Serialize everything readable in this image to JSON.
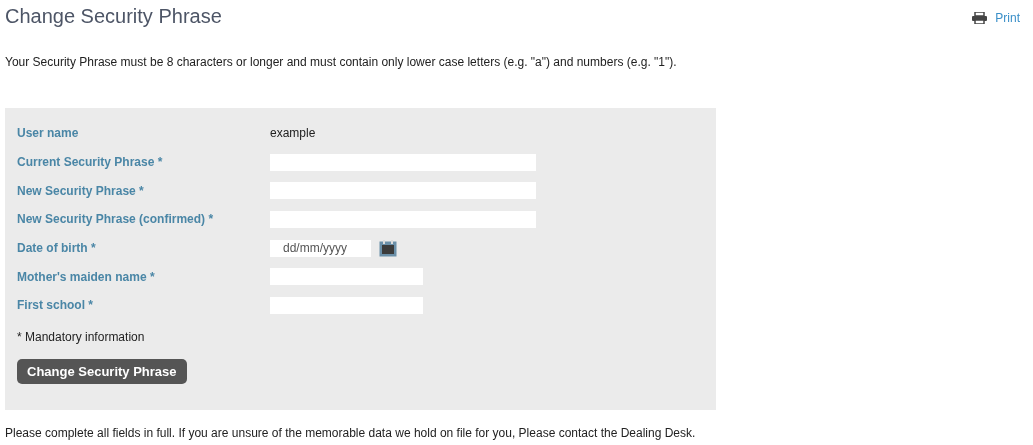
{
  "title": "Change Security Phrase",
  "print_link": "Print",
  "intro": "Your Security Phrase must be 8 characters or longer and must contain only lower case letters (e.g. \"a\") and numbers (e.g. \"1\").",
  "form": {
    "rows": [
      {
        "label": "User name",
        "kind": "value",
        "value": "example"
      },
      {
        "label": "Current Security Phrase *",
        "kind": "wide-input"
      },
      {
        "label": "New Security Phrase *",
        "kind": "wide-input"
      },
      {
        "label": "New Security Phrase (confirmed) *",
        "kind": "wide-input"
      },
      {
        "label": "Date of birth *",
        "kind": "date",
        "placeholder": "dd/mm/yyyy"
      },
      {
        "label": "Mother's maiden name *",
        "kind": "short-input"
      },
      {
        "label": "First school *",
        "kind": "short-input"
      }
    ],
    "mandatory_note": "* Mandatory information",
    "submit_button": "Change Security Phrase"
  },
  "footer": "Please complete all fields in full. If you are unsure of the memorable data we hold on file for you, Please contact the Dealing Desk."
}
